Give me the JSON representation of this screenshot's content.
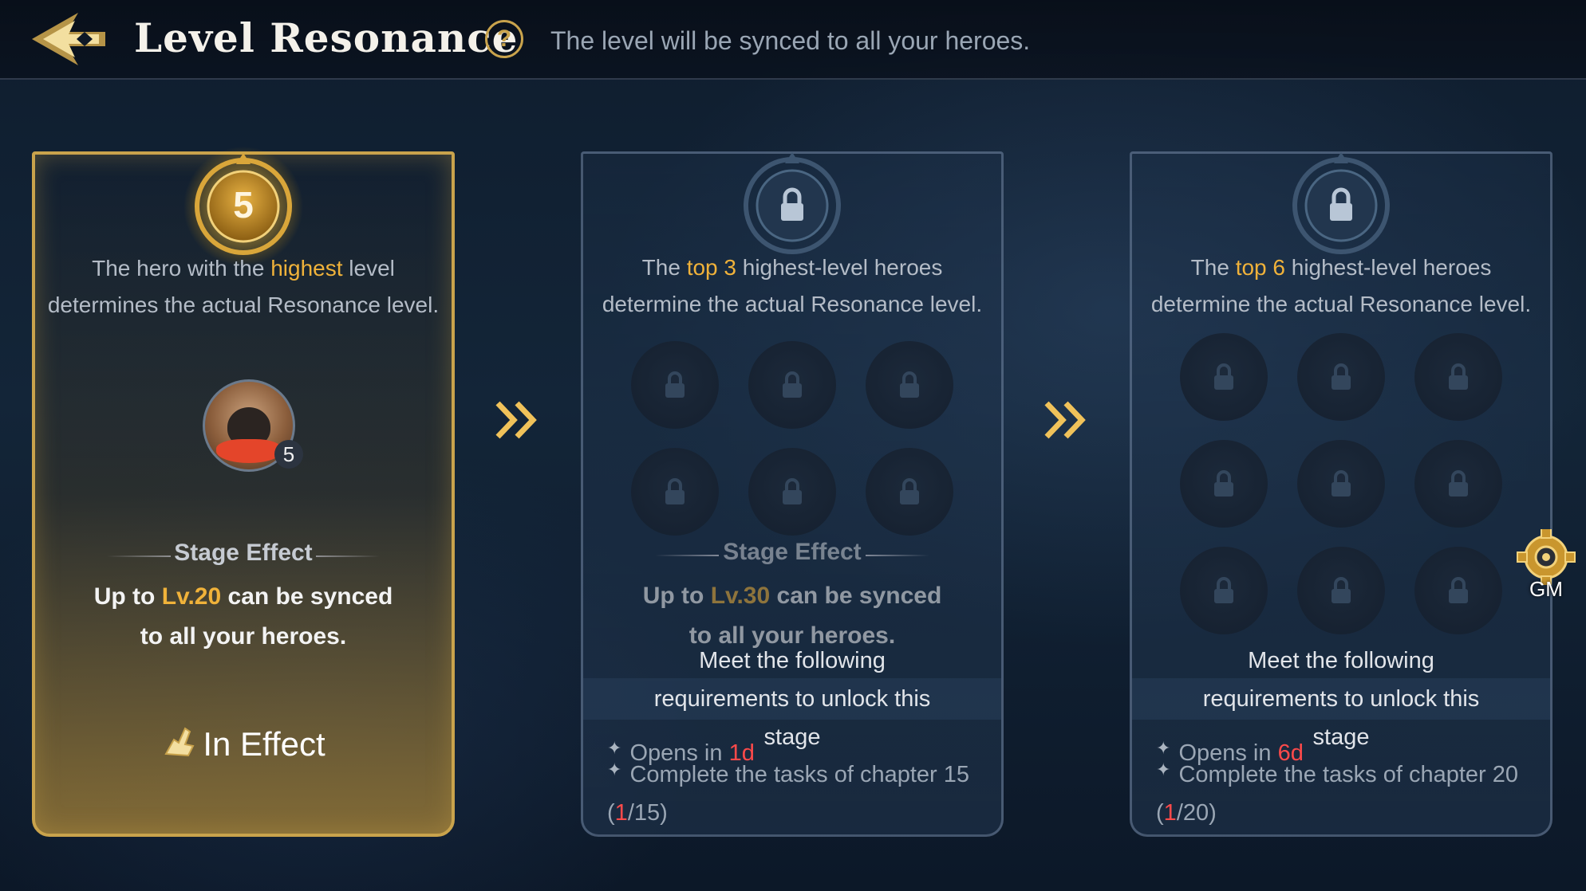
{
  "header": {
    "title": "Level Resonance",
    "help_icon": "?",
    "subtitle": "The level will be synced to all your heroes."
  },
  "stages": [
    {
      "badge": "5",
      "desc_line1_pre": "The hero with the ",
      "desc_line1_hl": "highest",
      "desc_line1_post": " level",
      "desc_line2": "determines the actual Resonance level.",
      "hero_level": "5",
      "stage_effect_label": "Stage Effect",
      "effect_pre": "Up to ",
      "effect_level": "Lv.20",
      "effect_post": " can be synced",
      "effect_line2": "to all your heroes.",
      "status": "In Effect"
    },
    {
      "desc_line1_pre": "The ",
      "desc_line1_hl": "top 3",
      "desc_line1_post": " highest-level heroes",
      "desc_line2": "determine the actual Resonance level.",
      "stage_effect_label": "Stage Effect",
      "effect_pre": "Up to ",
      "effect_level": "Lv.30",
      "effect_post": " can be synced",
      "effect_line2": "to all your heroes.",
      "req_line1": "Meet the following",
      "req_line2": "requirements to unlock this",
      "req_line3": "stage",
      "cond1_pre": "Opens in ",
      "cond1_time": "1d",
      "cond2_text": "Complete the tasks of chapter 15",
      "cond2_progress_current": "1",
      "cond2_progress_total": "/15"
    },
    {
      "desc_line1_pre": "The ",
      "desc_line1_hl": "top 6",
      "desc_line1_post": " highest-level heroes",
      "desc_line2": "determine the actual Resonance level.",
      "req_line1": "Meet the following",
      "req_line2": "requirements to unlock this",
      "req_line3": "stage",
      "cond1_pre": "Opens in ",
      "cond1_time": "6d",
      "cond2_text": "Complete the tasks of chapter 20",
      "cond2_progress_current": "1",
      "cond2_progress_total": "/20"
    }
  ],
  "gm_button": {
    "label": "GM"
  },
  "colors": {
    "accent_gold": "#f0b23a",
    "alert_red": "#ff4a4a",
    "active_border": "#c9a34c"
  }
}
